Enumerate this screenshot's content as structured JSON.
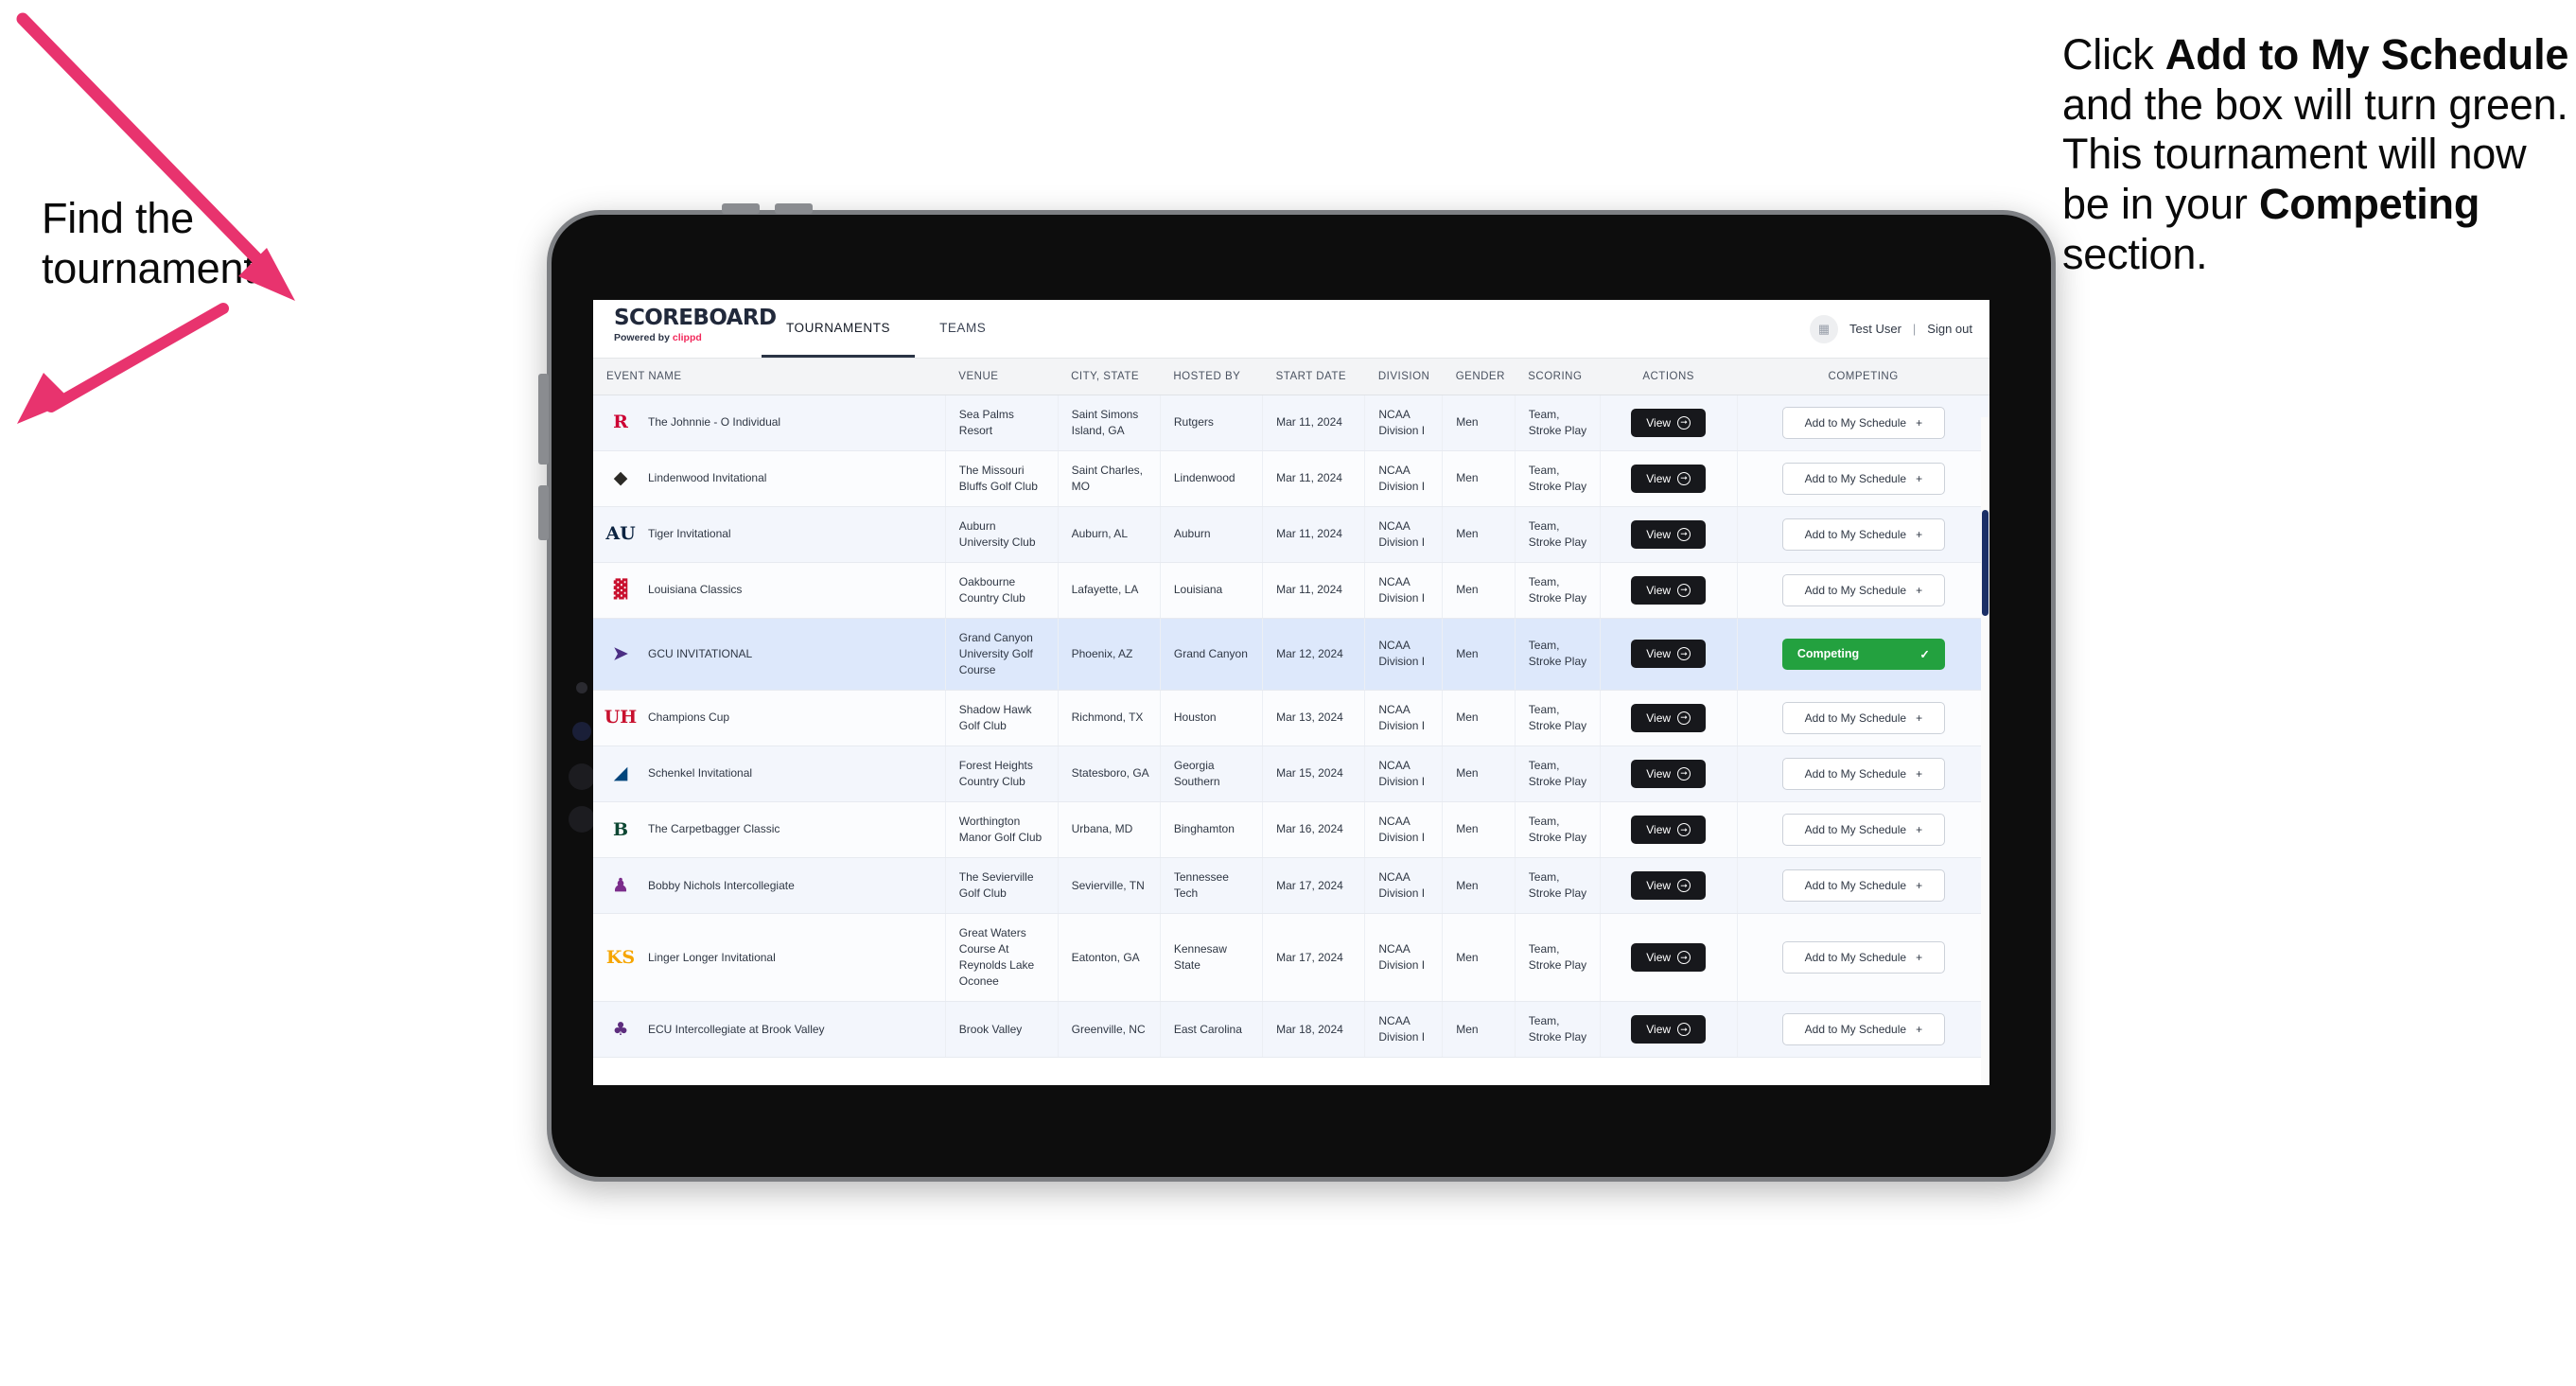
{
  "annotations": {
    "left": {
      "line1": "Find the",
      "line2": "tournament."
    },
    "right": {
      "pre": "Click ",
      "bold1": "Add to My Schedule",
      "mid": " and the box will turn green. This tournament will now be in your ",
      "bold2": "Competing",
      "post": " section."
    }
  },
  "app": {
    "brand": {
      "title": "SCOREBOARD",
      "powered_prefix": "Powered by ",
      "powered_brand": "clippd"
    },
    "nav": {
      "tabs": [
        {
          "label": "TOURNAMENTS",
          "active": true
        },
        {
          "label": "TEAMS",
          "active": false
        }
      ]
    },
    "account": {
      "avatar_icon": "grid-icon",
      "user_name": "Test User",
      "separator": "|",
      "sign_out": "Sign out"
    }
  },
  "table": {
    "columns": [
      "EVENT NAME",
      "VENUE",
      "CITY, STATE",
      "HOSTED BY",
      "START DATE",
      "DIVISION",
      "GENDER",
      "SCORING",
      "ACTIONS",
      "COMPETING"
    ],
    "buttons": {
      "view": "View",
      "view_icon": "arrow-right-circle-icon",
      "add": "Add to My Schedule",
      "add_icon": "plus-icon",
      "competing": "Competing",
      "competing_icon": "check-icon"
    },
    "rows": [
      {
        "logo_text": "R",
        "logo_color": "#cc0033",
        "logo_bg": "transparent",
        "event": "The Johnnie - O Individual",
        "venue": "Sea Palms Resort",
        "city": "Saint Simons Island, GA",
        "hosted_by": "Rutgers",
        "start_date": "Mar 11, 2024",
        "division": "NCAA Division I",
        "gender": "Men",
        "scoring": "Team, Stroke Play",
        "competing": false
      },
      {
        "logo_text": "◆",
        "logo_color": "#2b2a26",
        "logo_bg": "transparent",
        "event": "Lindenwood Invitational",
        "venue": "The Missouri Bluffs Golf Club",
        "city": "Saint Charles, MO",
        "hosted_by": "Lindenwood",
        "start_date": "Mar 11, 2024",
        "division": "NCAA Division I",
        "gender": "Men",
        "scoring": "Team, Stroke Play",
        "competing": false
      },
      {
        "logo_text": "AU",
        "logo_color": "#0b2341",
        "logo_bg": "transparent",
        "event": "Tiger Invitational",
        "venue": "Auburn University Club",
        "city": "Auburn, AL",
        "hosted_by": "Auburn",
        "start_date": "Mar 11, 2024",
        "division": "NCAA Division I",
        "gender": "Men",
        "scoring": "Team, Stroke Play",
        "competing": false
      },
      {
        "logo_text": "▓",
        "logo_color": "#c8102e",
        "logo_bg": "transparent",
        "event": "Louisiana Classics",
        "venue": "Oakbourne Country Club",
        "city": "Lafayette, LA",
        "hosted_by": "Louisiana",
        "start_date": "Mar 11, 2024",
        "division": "NCAA Division I",
        "gender": "Men",
        "scoring": "Team, Stroke Play",
        "competing": false
      },
      {
        "logo_text": "➤",
        "logo_color": "#4b2e83",
        "logo_bg": "transparent",
        "event": "GCU INVITATIONAL",
        "venue": "Grand Canyon University Golf Course",
        "city": "Phoenix, AZ",
        "hosted_by": "Grand Canyon",
        "start_date": "Mar 12, 2024",
        "division": "NCAA Division I",
        "gender": "Men",
        "scoring": "Team, Stroke Play",
        "competing": true
      },
      {
        "logo_text": "UH",
        "logo_color": "#c8102e",
        "logo_bg": "transparent",
        "event": "Champions Cup",
        "venue": "Shadow Hawk Golf Club",
        "city": "Richmond, TX",
        "hosted_by": "Houston",
        "start_date": "Mar 13, 2024",
        "division": "NCAA Division I",
        "gender": "Men",
        "scoring": "Team, Stroke Play",
        "competing": false
      },
      {
        "logo_text": "◢",
        "logo_color": "#00457c",
        "logo_bg": "transparent",
        "event": "Schenkel Invitational",
        "venue": "Forest Heights Country Club",
        "city": "Statesboro, GA",
        "hosted_by": "Georgia Southern",
        "start_date": "Mar 15, 2024",
        "division": "NCAA Division I",
        "gender": "Men",
        "scoring": "Team, Stroke Play",
        "competing": false
      },
      {
        "logo_text": "B",
        "logo_color": "#0d4733",
        "logo_bg": "transparent",
        "event": "The Carpetbagger Classic",
        "venue": "Worthington Manor Golf Club",
        "city": "Urbana, MD",
        "hosted_by": "Binghamton",
        "start_date": "Mar 16, 2024",
        "division": "NCAA Division I",
        "gender": "Men",
        "scoring": "Team, Stroke Play",
        "competing": false
      },
      {
        "logo_text": "♟",
        "logo_color": "#7b2d8b",
        "logo_bg": "transparent",
        "event": "Bobby Nichols Intercollegiate",
        "venue": "The Sevierville Golf Club",
        "city": "Sevierville, TN",
        "hosted_by": "Tennessee Tech",
        "start_date": "Mar 17, 2024",
        "division": "NCAA Division I",
        "gender": "Men",
        "scoring": "Team, Stroke Play",
        "competing": false
      },
      {
        "logo_text": "KS",
        "logo_color": "#f6a500",
        "logo_bg": "transparent",
        "event": "Linger Longer Invitational",
        "venue": "Great Waters Course At Reynolds Lake Oconee",
        "city": "Eatonton, GA",
        "hosted_by": "Kennesaw State",
        "start_date": "Mar 17, 2024",
        "division": "NCAA Division I",
        "gender": "Men",
        "scoring": "Team, Stroke Play",
        "competing": false
      },
      {
        "logo_text": "♣",
        "logo_color": "#5d2d7e",
        "logo_bg": "transparent",
        "event": "ECU Intercollegiate at Brook Valley",
        "venue": "Brook Valley",
        "city": "Greenville, NC",
        "hosted_by": "East Carolina",
        "start_date": "Mar 18, 2024",
        "division": "NCAA Division I",
        "gender": "Men",
        "scoring": "Team, Stroke Play",
        "competing": false
      }
    ]
  },
  "colors": {
    "accent_pink": "#e8336e",
    "competing_green": "#23a13f",
    "row_selected_blue": "#dde8fb",
    "brand_red": "#f2295b"
  }
}
